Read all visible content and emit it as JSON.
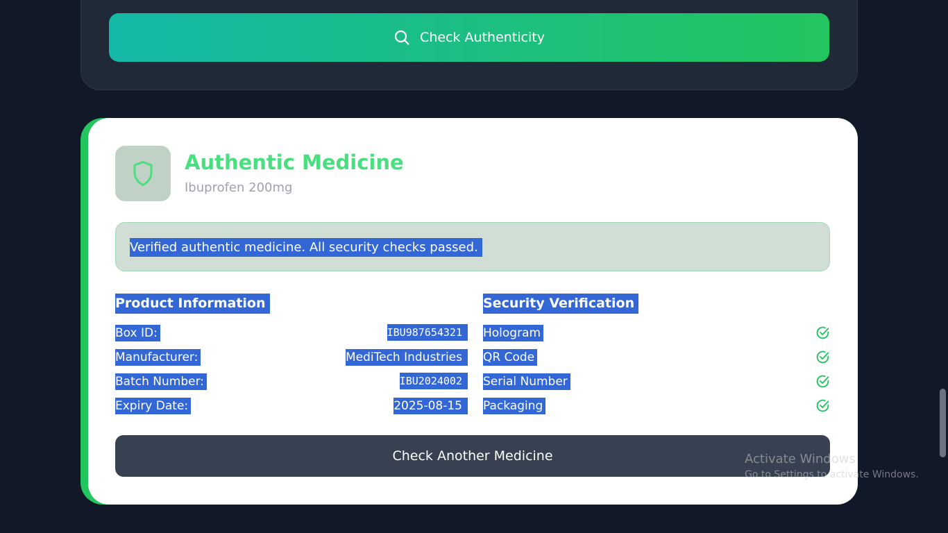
{
  "scan_form": {
    "check_button_label": "Check Authenticity",
    "check_button_icon": "search-icon"
  },
  "result": {
    "status_icon": "shield-icon",
    "title": "Authentic Medicine",
    "product_name": "Ibuprofen 200mg",
    "notice": "Verified authentic medicine. All security checks passed.",
    "product_info": {
      "heading": "Product Information",
      "rows": [
        {
          "label": "Box ID:",
          "value": "IBU987654321"
        },
        {
          "label": "Manufacturer:",
          "value": "MediTech Industries"
        },
        {
          "label": "Batch Number:",
          "value": "IBU2024002"
        },
        {
          "label": "Expiry Date:",
          "value": "2025-08-15"
        }
      ]
    },
    "security": {
      "heading": "Security Verification",
      "check_icon": "check-circle-icon",
      "items": [
        {
          "label": "Hologram",
          "status": "passed"
        },
        {
          "label": "QR Code",
          "status": "passed"
        },
        {
          "label": "Serial Number",
          "status": "passed"
        },
        {
          "label": "Packaging",
          "status": "passed"
        }
      ]
    },
    "another_button_label": "Check Another Medicine"
  },
  "watermark": {
    "title": "Activate Windows",
    "subtitle": "Go to Settings to activate Windows."
  },
  "colors": {
    "background": "#111827",
    "accent_green": "#22c55e",
    "title_green": "#4ade80",
    "selection": "#3367d6"
  }
}
